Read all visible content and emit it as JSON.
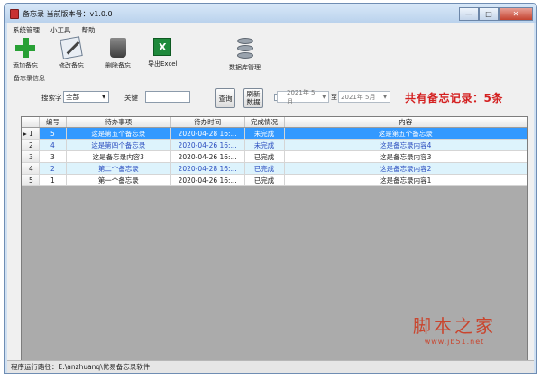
{
  "window": {
    "title": "备忘录  当前版本号：v1.0.0",
    "controls": {
      "minimize": "—",
      "maximize": "□",
      "close": "✕"
    }
  },
  "menu": [
    "系统管理",
    "小工具",
    "帮助"
  ],
  "toolbar": {
    "add": "添加备忘",
    "edit": "修改备忘",
    "delete": "删除备忘",
    "export": "导出Excel",
    "database": "数据库管理",
    "group_label": "备忘录信息",
    "excel_glyph": "X"
  },
  "search": {
    "field_label": "搜索字",
    "field_value": "全部",
    "keyword_label": "关键",
    "keyword_value": "",
    "query_button": "查询",
    "refresh_button": "刷新数据",
    "date_start": "2021年 5月",
    "date_end": "2021年 5月",
    "date_sep": "至",
    "summary": "共有备忘记录：5条"
  },
  "table": {
    "columns": [
      "",
      "编号",
      "待办事项",
      "待办时间",
      "完成情况",
      "内容"
    ],
    "rows": [
      {
        "marker": "▸",
        "index": "1",
        "id": "5",
        "task": "这是第五个备忘录",
        "time": "2020-04-28 16:...",
        "status": "未完成",
        "content": "这是第五个备忘录",
        "style": "selected"
      },
      {
        "marker": "",
        "index": "2",
        "id": "4",
        "task": "这是第四个备忘录",
        "time": "2020-04-26 16:...",
        "status": "未完成",
        "content": "这是备忘录内容4",
        "style": "alt"
      },
      {
        "marker": "",
        "index": "3",
        "id": "3",
        "task": "这是备忘录内容3",
        "time": "2020-04-26 16:...",
        "status": "已完成",
        "content": "这是备忘录内容3",
        "style": "plain"
      },
      {
        "marker": "",
        "index": "4",
        "id": "2",
        "task": "第二个备忘录",
        "time": "2020-04-28 16:...",
        "status": "已完成",
        "content": "这是备忘录内容2",
        "style": "alt"
      },
      {
        "marker": "",
        "index": "5",
        "id": "1",
        "task": "第一个备忘录",
        "time": "2020-04-26 16:...",
        "status": "已完成",
        "content": "这是备忘录内容1",
        "style": "plain"
      }
    ]
  },
  "status": {
    "path": "程序运行路径：E:\\anzhuanq\\优易备忘录软件"
  },
  "watermark": {
    "main": "脚本之家",
    "sub": "www.jb51.net"
  },
  "colors": {
    "selected_row": "#3399ff",
    "alt_row": "#ddf3fc",
    "summary": "#d42020"
  }
}
